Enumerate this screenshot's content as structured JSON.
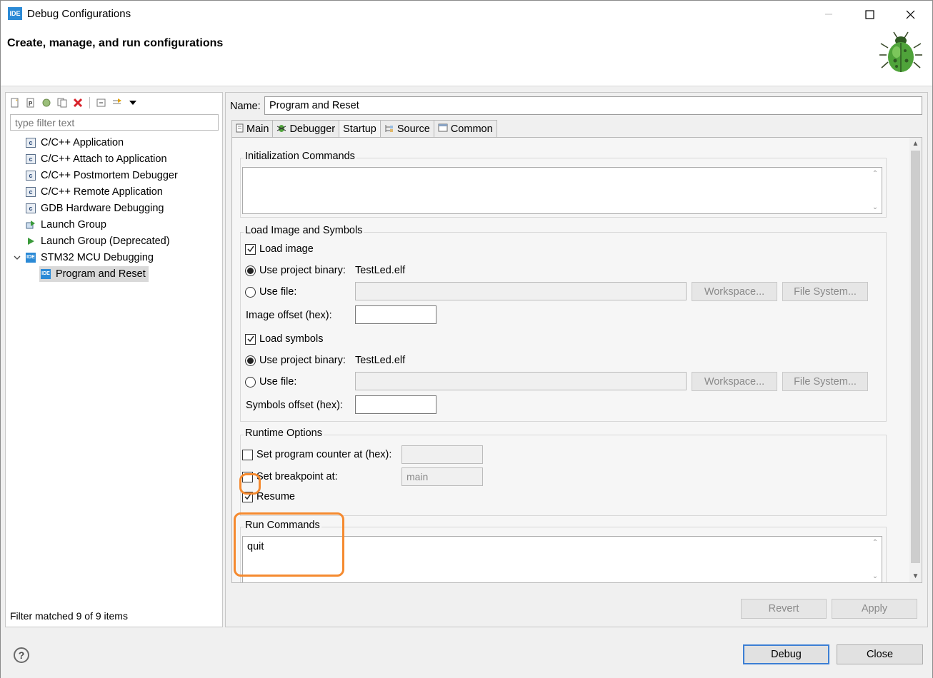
{
  "window": {
    "title": "Debug Configurations",
    "app_icon": "IDE",
    "banner_title": "Create, manage, and run configurations"
  },
  "left": {
    "toolbar_icons": [
      "new-config-icon",
      "new-prototype-icon",
      "export-icon",
      "duplicate-icon",
      "delete-icon",
      "collapse-all-icon",
      "filter-icon",
      "dropdown-icon"
    ],
    "filter_placeholder": "type filter text",
    "tree": [
      {
        "label": "C/C++ Application",
        "icon": "c-icon"
      },
      {
        "label": "C/C++ Attach to Application",
        "icon": "c-icon"
      },
      {
        "label": "C/C++ Postmortem Debugger",
        "icon": "c-icon"
      },
      {
        "label": "C/C++ Remote Application",
        "icon": "c-icon"
      },
      {
        "label": "GDB Hardware Debugging",
        "icon": "c-icon"
      },
      {
        "label": "Launch Group",
        "icon": "launch-group-icon"
      },
      {
        "label": "Launch Group (Deprecated)",
        "icon": "launch-arrow-icon"
      },
      {
        "label": "STM32 MCU Debugging",
        "icon": "ide-icon"
      },
      {
        "label": "Program and Reset",
        "icon": "ide-icon"
      }
    ],
    "filter_status": "Filter matched 9 of 9 items"
  },
  "right": {
    "name_label": "Name:",
    "name_value": "Program and Reset",
    "tabs": [
      {
        "label": "Main",
        "icon": "page-icon"
      },
      {
        "label": "Debugger",
        "icon": "bug-icon"
      },
      {
        "label": "Startup",
        "icon": ""
      },
      {
        "label": "Source",
        "icon": "source-icon"
      },
      {
        "label": "Common",
        "icon": "common-icon"
      }
    ],
    "init": {
      "title": "Initialization Commands",
      "value": ""
    },
    "load": {
      "title": "Load Image and Symbols",
      "load_image": "Load image",
      "use_project_binary": "Use project binary:",
      "binary_value": "TestLed.elf",
      "use_file": "Use file:",
      "workspace": "Workspace...",
      "file_system": "File System...",
      "image_offset": "Image offset (hex):",
      "load_symbols": "Load symbols",
      "symbols_offset": "Symbols offset (hex):"
    },
    "runtime": {
      "title": "Runtime Options",
      "set_pc": "Set program counter at (hex):",
      "set_breakpoint": "Set breakpoint at:",
      "breakpoint_value": "main",
      "resume": "Resume"
    },
    "run": {
      "title": "Run Commands",
      "value": "quit"
    },
    "revert": "Revert",
    "apply": "Apply"
  },
  "bottom": {
    "help_icon": "?",
    "debug": "Debug",
    "close": "Close"
  },
  "colors": {
    "highlight": "#f58a2f",
    "accent": "#3c7fd4"
  }
}
